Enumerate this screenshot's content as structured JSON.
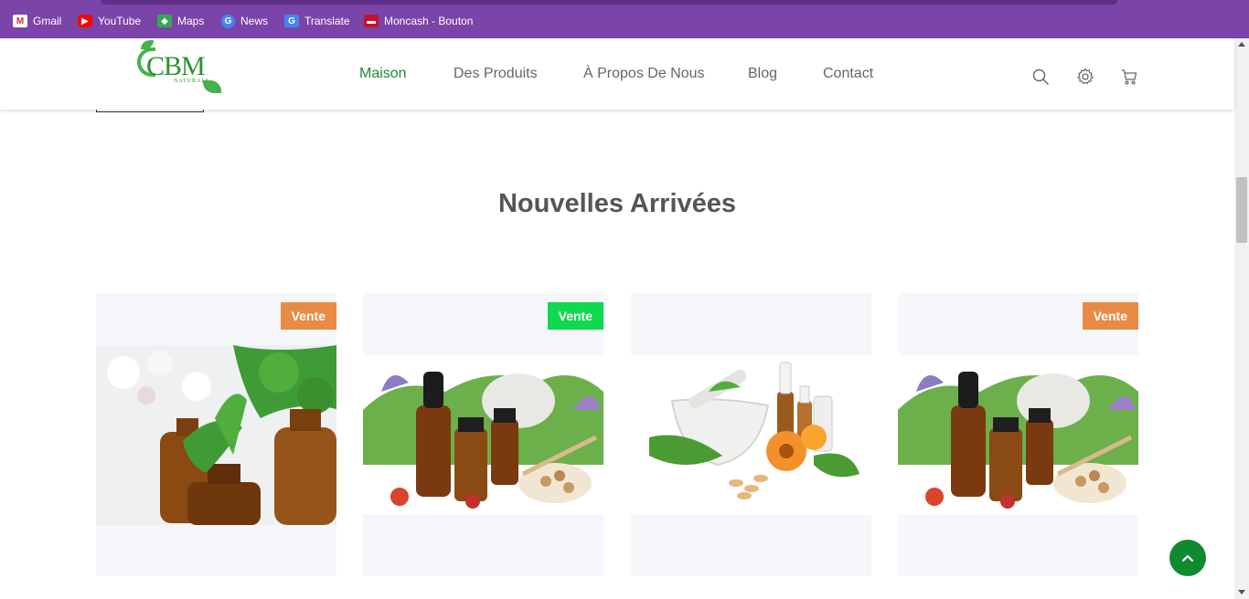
{
  "bookmarks": [
    {
      "label": "Gmail",
      "icon": "gmail-icon",
      "glyph": "M"
    },
    {
      "label": "YouTube",
      "icon": "youtube-icon",
      "glyph": "▶"
    },
    {
      "label": "Maps",
      "icon": "maps-icon",
      "glyph": "◆"
    },
    {
      "label": "News",
      "icon": "news-icon",
      "glyph": "G"
    },
    {
      "label": "Translate",
      "icon": "translate-icon",
      "glyph": "G"
    },
    {
      "label": "Moncash - Bouton",
      "icon": "moncash-icon",
      "glyph": "▬"
    }
  ],
  "header": {
    "logo_text": "CBM",
    "logo_sub": "NATURALS",
    "nav": [
      {
        "label": "Maison",
        "active": true
      },
      {
        "label": "Des Produits",
        "active": false
      },
      {
        "label": "À Propos De Nous",
        "active": false
      },
      {
        "label": "Blog",
        "active": false
      },
      {
        "label": "Contact",
        "active": false
      }
    ]
  },
  "section": {
    "title": "Nouvelles Arrivées"
  },
  "products": [
    {
      "badge": "Vente",
      "badge_color": "#e98b45",
      "image": "amber-bottles-with-herbs"
    },
    {
      "badge": "Vente",
      "badge_color": "#10d84f",
      "image": "essential-oils-with-flowers"
    },
    {
      "badge": "",
      "badge_color": "",
      "image": "mortar-with-calendula"
    },
    {
      "badge": "Vente",
      "badge_color": "#e98b45",
      "image": "essential-oils-with-flowers"
    }
  ],
  "colors": {
    "bookmarks_bar": "#7b44a8",
    "accent_green": "#1a8a3a",
    "back_to_top": "#0f8a2e"
  }
}
